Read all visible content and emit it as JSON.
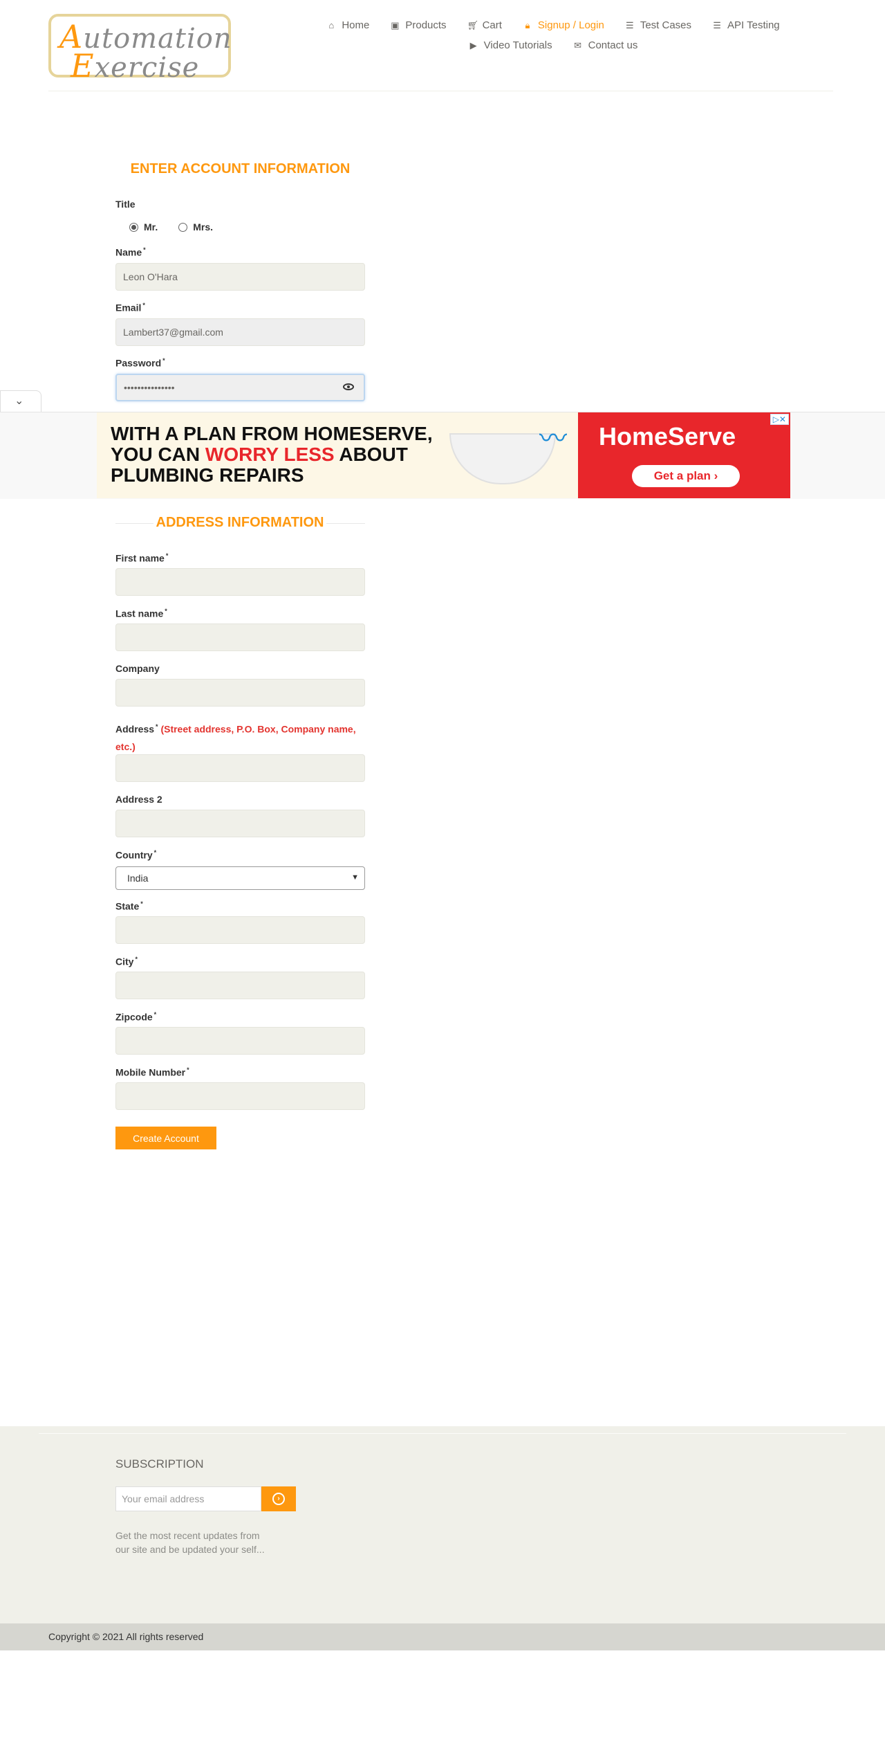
{
  "brand": {
    "logo_line1_first": "A",
    "logo_line1_rest": "utomation",
    "logo_line2_first": "E",
    "logo_line2_rest": "xercise"
  },
  "nav": {
    "row1": [
      {
        "label": "Home",
        "icon": "home-icon"
      },
      {
        "label": "Products",
        "icon": "shopping-bag-icon"
      },
      {
        "label": "Cart",
        "icon": "cart-icon"
      },
      {
        "label": "Signup / Login",
        "icon": "lock-icon",
        "active": true
      },
      {
        "label": "Test Cases",
        "icon": "list-icon"
      },
      {
        "label": "API Testing",
        "icon": "list-icon"
      }
    ],
    "row2": [
      {
        "label": "Video Tutorials",
        "icon": "youtube-icon"
      },
      {
        "label": "Contact us",
        "icon": "envelope-icon"
      }
    ]
  },
  "account": {
    "section_title": "ENTER ACCOUNT INFORMATION",
    "title_label": "Title",
    "title_options": [
      "Mr.",
      "Mrs."
    ],
    "title_selected": "Mr.",
    "name_label": "Name",
    "name_value": "Leon O'Hara",
    "email_label": "Email",
    "email_value": "Lambert37@gmail.com",
    "password_label": "Password",
    "password_value": "•••••••••••••••",
    "required_mark": "*"
  },
  "ad": {
    "line1": "WITH A PLAN FROM HOMESERVE,",
    "line2a": "YOU CAN ",
    "line2b": "WORRY LESS",
    "line2c": " ABOUT",
    "line3": "PLUMBING REPAIRS",
    "brand": "HomeServe",
    "cta": "Get a plan ›",
    "ad_choices": "▷✕",
    "accent_color": "#e8262b"
  },
  "address": {
    "section_title": "ADDRESS INFORMATION",
    "first_name_label": "First name",
    "last_name_label": "Last name",
    "company_label": "Company",
    "address_label": "Address",
    "address_note": "(Street address, P.O. Box, Company name, etc.)",
    "address2_label": "Address 2",
    "country_label": "Country",
    "country_value": "India",
    "state_label": "State",
    "city_label": "City",
    "zipcode_label": "Zipcode",
    "mobile_label": "Mobile Number",
    "submit_label": "Create Account"
  },
  "footer": {
    "subscription_title": "SUBSCRIPTION",
    "email_placeholder": "Your email address",
    "subscribe_text": "Get the most recent updates from our site and be updated your self...",
    "copyright": "Copyright © 2021 All rights reserved"
  },
  "colors": {
    "accent": "#fe980f",
    "footer_bg": "#f0f0e9",
    "required_note": "#e3342f"
  }
}
